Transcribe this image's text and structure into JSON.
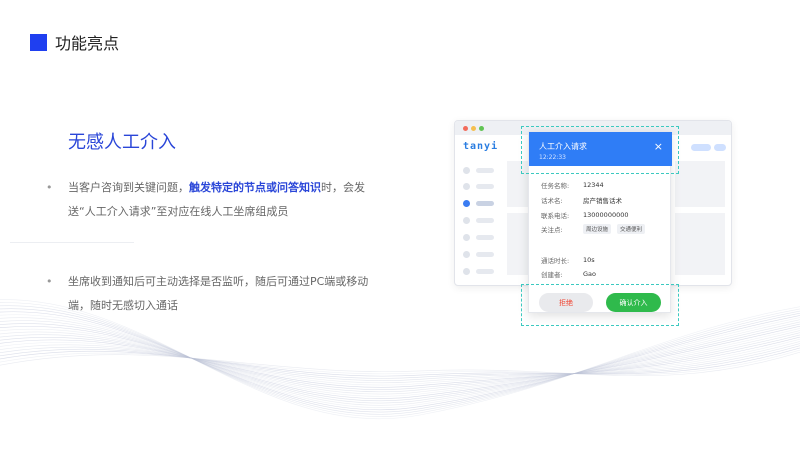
{
  "header": {
    "title": "功能亮点"
  },
  "feature": {
    "title": "无感人工介入",
    "bullet1_pre": "当客户咨询到关键问题，",
    "bullet1_hl": "触发特定的节点或问答知识",
    "bullet1_post": "时，会发送“人工介入请求”至对应在线人工坐席组成员",
    "bullet2": "坐席收到通知后可主动选择是否监听，随后可通过PC端或移动端，随时无感切入通话",
    "bullet_glyph": "•"
  },
  "app": {
    "logo": "tanyi",
    "window_dot_colors": [
      "#f26b5b",
      "#f5bf4f",
      "#61c454"
    ]
  },
  "dialog": {
    "title": "人工介入请求",
    "time": "12:22:33",
    "close": "×",
    "task_name_label": "任务名称:",
    "task_name": "12344",
    "script_label": "话术名:",
    "script": "房产销售话术",
    "phone_label": "联系电话:",
    "phone": "13000000000",
    "focus_label": "关注点:",
    "focus_tags": [
      "周边设施",
      "交通便利"
    ],
    "duration_label": "通话时长:",
    "duration": "10s",
    "creator_label": "创建者:",
    "creator": "Gao",
    "reject_label": "拒绝",
    "confirm_label": "确认介入"
  },
  "colors": {
    "accent": "#2a46d8",
    "brand_square": "#1f3ff0",
    "dialog_header": "#2f7df6",
    "confirm": "#2fba4c",
    "reject_text": "#f0432f",
    "dash": "#3cc9c0",
    "wave": "#bcc2d6"
  }
}
